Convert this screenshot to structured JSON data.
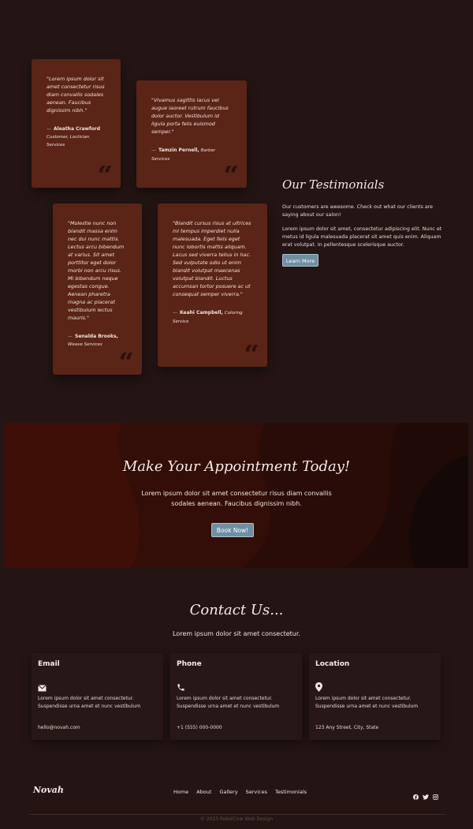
{
  "testimonials": {
    "title": "Our Testimonials",
    "p1": "Our customers are awesome. Check out what our clients are saying about our salon!",
    "p2": "Lorem ipsum dolor sit amet, consectetur adipiscing elit. Nunc et metus id ligula malesuada placerat sit amet quis enim. Aliquam erat volutpat. In pellentesque scelerisque auctor.",
    "button": "Learn More",
    "quote_glyph": "“",
    "cards": [
      {
        "quote": "\"Lorem ipsum dolor sit amet consectetur risus diam convallis sodales aenean. Faucibus dignissim nibh.\"",
        "dash": "—",
        "name": "Aleatha Crawford",
        "role": "Customer, Loctician Services"
      },
      {
        "quote": "\"Vivamus sagittis lacus vel augue laoreet rutrum faucibus dolor auctor. Vestibulum id ligula porta felis euismod semper.\"",
        "dash": "—",
        "name": "Tamzin Pernell,",
        "role": "Barber Services"
      },
      {
        "quote": "\"Molestie nunc non blandit massa enim nec dui nunc mattis. Lectus arcu bibendum at varius. Sit amet porttitor eget dolor morbi non arcu risus. Mi bibendum neque egestas congue. Aenean pharetra magna ac placerat vestibulum lectus mauris.\"",
        "dash": "—",
        "name": "Senalda Brooks,",
        "role": "Weave Services"
      },
      {
        "quote": "\"Blandit cursus risus at ultrices mi tempus imperdiet nulla malesuada. Eget felis eget nunc lobortis mattis aliquam. Lacus sed viverra tellus in hac. Sed vulputate odio ut enim blandit volutpat maecenas volutpat blandit. Luctus accumsan tortor posuere ac ut consequat semper viverra.\"",
        "dash": "—",
        "name": "Keahi Campbell,",
        "role": "Coloring Service"
      }
    ]
  },
  "appointment": {
    "title": "Make Your Appointment Today!",
    "text": "Lorem ipsum dolor sit amet consectetur risus diam convallis sodales aenean. Faucibus dignissim nibh.",
    "button": "Book Now!"
  },
  "contact": {
    "title": "Contact Us...",
    "subtitle": "Lorem ipsum dolor sit amet consectetur.",
    "cards": [
      {
        "heading": "Email",
        "icon": "envelope-icon",
        "desc": "Lorem ipsum dolor sit amet consectetur. Suspendisse urna amet et nunc vestibulum",
        "value": "hello@novah.com"
      },
      {
        "heading": "Phone",
        "icon": "phone-icon",
        "desc": "Lorem ipsum dolor sit amet consectetur. Suspendisse urna amet et nunc vestibulum",
        "value": "+1 (555) 000-0000"
      },
      {
        "heading": "Location",
        "icon": "map-pin-icon",
        "desc": "Lorem ipsum dolor sit amet consectetur. Suspendisse urna amet et nunc vestibulum",
        "value": "123 Any Street, City, State"
      }
    ]
  },
  "footer": {
    "logo": "Novah",
    "nav": [
      "Home",
      "About",
      "Gallery",
      "Services",
      "Testimonials"
    ],
    "social_icons": [
      "facebook-icon",
      "twitter-icon",
      "instagram-icon"
    ],
    "copyright": "© 2023 RebelCow Web Design"
  },
  "colors": {
    "page_bg": "#241514",
    "card_bg": "#5a2417",
    "button": "#6f8fa3",
    "banner_bg": "#3a0f08"
  }
}
